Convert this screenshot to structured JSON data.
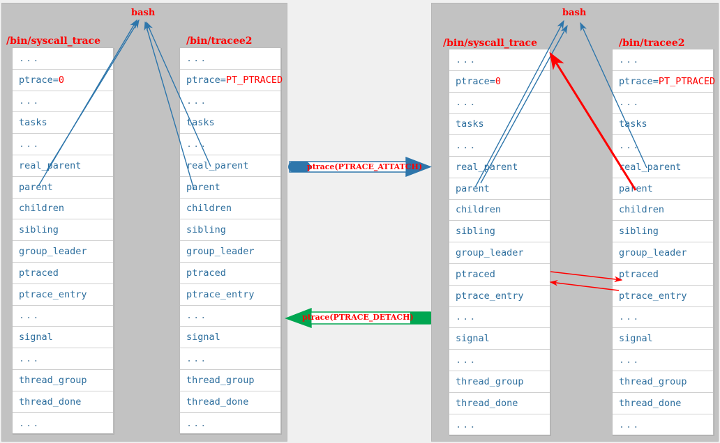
{
  "diagram": {
    "title_color": "#ff0000",
    "field_color": "#2e6f9e",
    "panel_bg": "#c2c2c2",
    "blue_arrow_color": "#2e76ab",
    "red_arrow_color": "#ff0000",
    "green_arrow_color": "#00a651"
  },
  "left_panel": {
    "bash_label": "bash",
    "tracer": {
      "title": "/bin/syscall_trace",
      "rows": [
        {
          "text": "...",
          "dots": true
        },
        {
          "text": "ptrace=",
          "highlight": "0"
        },
        {
          "text": "...",
          "dots": true
        },
        {
          "text": "tasks"
        },
        {
          "text": "...",
          "dots": true
        },
        {
          "text": "real_parent"
        },
        {
          "text": "parent"
        },
        {
          "text": "children"
        },
        {
          "text": "sibling"
        },
        {
          "text": "group_leader"
        },
        {
          "text": "ptraced"
        },
        {
          "text": "ptrace_entry"
        },
        {
          "text": "...",
          "dots": true
        },
        {
          "text": "signal"
        },
        {
          "text": "...",
          "dots": true
        },
        {
          "text": "thread_group"
        },
        {
          "text": "thread_done"
        },
        {
          "text": "...",
          "dots": true
        }
      ]
    },
    "tracee": {
      "title": "/bin/tracee2",
      "rows": [
        {
          "text": "...",
          "dots": true
        },
        {
          "text": "ptrace=",
          "highlight": "PT_PTRACED"
        },
        {
          "text": "...",
          "dots": true
        },
        {
          "text": "tasks"
        },
        {
          "text": "...",
          "dots": true
        },
        {
          "text": "real_parent"
        },
        {
          "text": "parent"
        },
        {
          "text": "children"
        },
        {
          "text": "sibling"
        },
        {
          "text": "group_leader"
        },
        {
          "text": "ptraced"
        },
        {
          "text": "ptrace_entry"
        },
        {
          "text": "...",
          "dots": true
        },
        {
          "text": "signal"
        },
        {
          "text": "...",
          "dots": true
        },
        {
          "text": "thread_group"
        },
        {
          "text": "thread_done"
        },
        {
          "text": "...",
          "dots": true
        }
      ]
    }
  },
  "right_panel": {
    "bash_label": "bash",
    "tracer": {
      "title": "/bin/syscall_trace",
      "rows": [
        {
          "text": "...",
          "dots": true
        },
        {
          "text": "ptrace=",
          "highlight": "0"
        },
        {
          "text": "...",
          "dots": true
        },
        {
          "text": "tasks"
        },
        {
          "text": "...",
          "dots": true
        },
        {
          "text": "real_parent"
        },
        {
          "text": "parent"
        },
        {
          "text": "children"
        },
        {
          "text": "sibling"
        },
        {
          "text": "group_leader"
        },
        {
          "text": "ptraced"
        },
        {
          "text": "ptrace_entry"
        },
        {
          "text": "...",
          "dots": true
        },
        {
          "text": "signal"
        },
        {
          "text": "...",
          "dots": true
        },
        {
          "text": "thread_group"
        },
        {
          "text": "thread_done"
        },
        {
          "text": "...",
          "dots": true
        }
      ]
    },
    "tracee": {
      "title": "/bin/tracee2",
      "rows": [
        {
          "text": "...",
          "dots": true
        },
        {
          "text": "ptrace=",
          "highlight": "PT_PTRACED"
        },
        {
          "text": "...",
          "dots": true
        },
        {
          "text": "tasks"
        },
        {
          "text": "...",
          "dots": true
        },
        {
          "text": "real_parent"
        },
        {
          "text": "parent"
        },
        {
          "text": "children"
        },
        {
          "text": "sibling"
        },
        {
          "text": "group_leader"
        },
        {
          "text": "ptraced"
        },
        {
          "text": "ptrace_entry"
        },
        {
          "text": "...",
          "dots": true
        },
        {
          "text": "signal"
        },
        {
          "text": "...",
          "dots": true
        },
        {
          "text": "thread_group"
        },
        {
          "text": "thread_done"
        },
        {
          "text": "...",
          "dots": true
        }
      ]
    }
  },
  "middle": {
    "attach_label": "ptrace(PTRACE_ATTATCH)",
    "detach_label": "ptrace(PTRACE_DETACH)"
  }
}
